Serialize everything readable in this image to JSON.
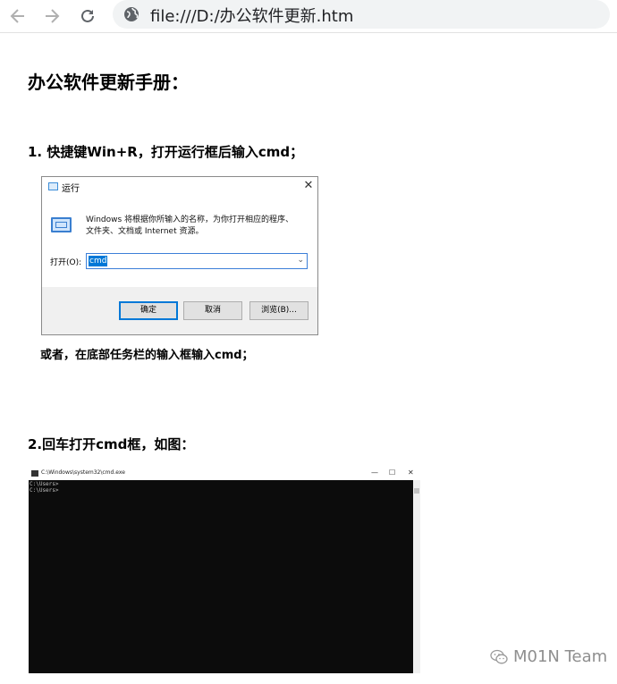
{
  "browser": {
    "url": "file:///D:/办公软件更新.htm",
    "back_icon": "arrow-left-icon",
    "forward_icon": "arrow-right-icon",
    "reload_icon": "reload-icon",
    "site_icon": "globe-icon"
  },
  "page": {
    "title": "办公软件更新手册：",
    "step1": "1. 快捷键Win+R，打开运行框后输入cmd；",
    "note": "或者，在底部任务栏的输入框输入cmd；",
    "step2": "2.回车打开cmd框，如图："
  },
  "run_dialog": {
    "title": "运行",
    "close": "✕",
    "desc_line1": "Windows 将根据你所输入的名称，为你打开相应的程序、",
    "desc_line2": "文件夹、文档或 Internet 资源。",
    "open_label": "打开(O):",
    "input_value": "cmd",
    "ok_button": "确定",
    "cancel_button": "取消",
    "browse_button": "浏览(B)..."
  },
  "cmd_window": {
    "title": "C:\\Windows\\system32\\cmd.exe",
    "minimize": "—",
    "maximize": "☐",
    "close": "✕",
    "line1": "C:\\Users>",
    "line2": "C:\\Users>"
  },
  "watermark": {
    "text": "M01N Team"
  },
  "colors": {
    "accent": "#0078d7",
    "cmd_background": "#0c0c0c",
    "omnibox": "#f1f3f4"
  }
}
